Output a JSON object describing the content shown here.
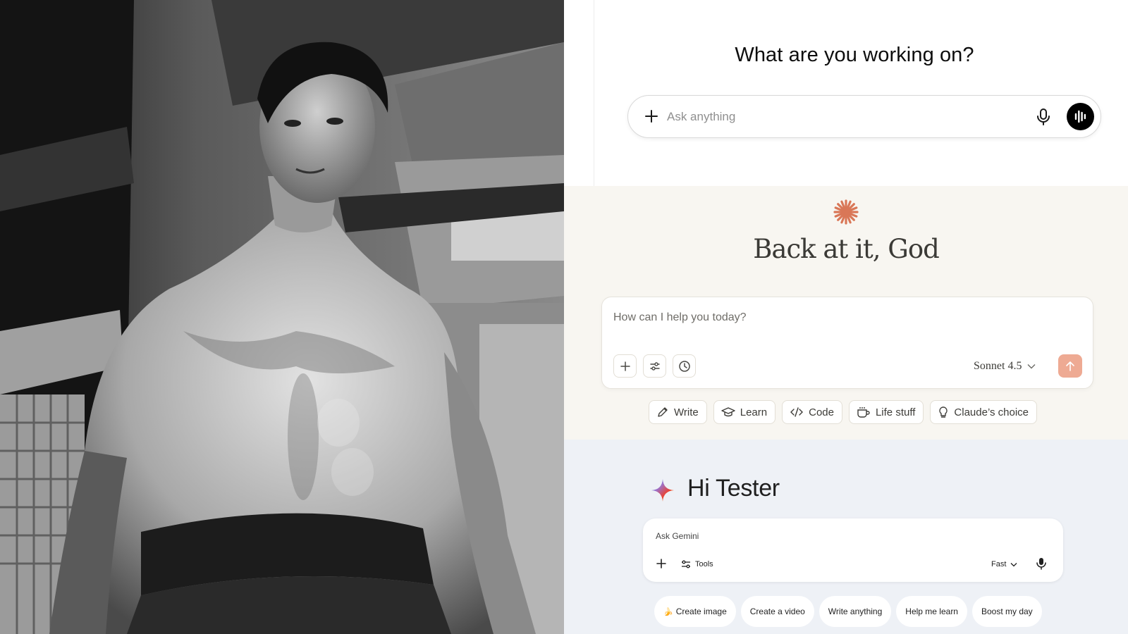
{
  "chatgpt": {
    "heading": "What are you working on?",
    "input_placeholder": "Ask anything",
    "icons": [
      "plus-icon",
      "microphone-icon",
      "voice-mode-icon"
    ]
  },
  "claude": {
    "greeting": "Back at it, God",
    "input_placeholder": "How can I help you today?",
    "model": "Sonnet 4.5",
    "accent_color": "#d97757",
    "chips": [
      {
        "label": "Write",
        "icon": "pencil-icon"
      },
      {
        "label": "Learn",
        "icon": "graduation-cap-icon"
      },
      {
        "label": "Code",
        "icon": "code-icon"
      },
      {
        "label": "Life stuff",
        "icon": "coffee-cup-icon"
      },
      {
        "label": "Claude’s choice",
        "icon": "lightbulb-icon"
      }
    ]
  },
  "gemini": {
    "greeting": "Hi Tester",
    "input_placeholder": "Ask Gemini",
    "tools_label": "Tools",
    "mode_label": "Fast",
    "chips": [
      {
        "label": "Create image",
        "emoji": "🍌"
      },
      {
        "label": "Create a video"
      },
      {
        "label": "Write anything"
      },
      {
        "label": "Help me learn"
      },
      {
        "label": "Boost my day"
      }
    ]
  }
}
